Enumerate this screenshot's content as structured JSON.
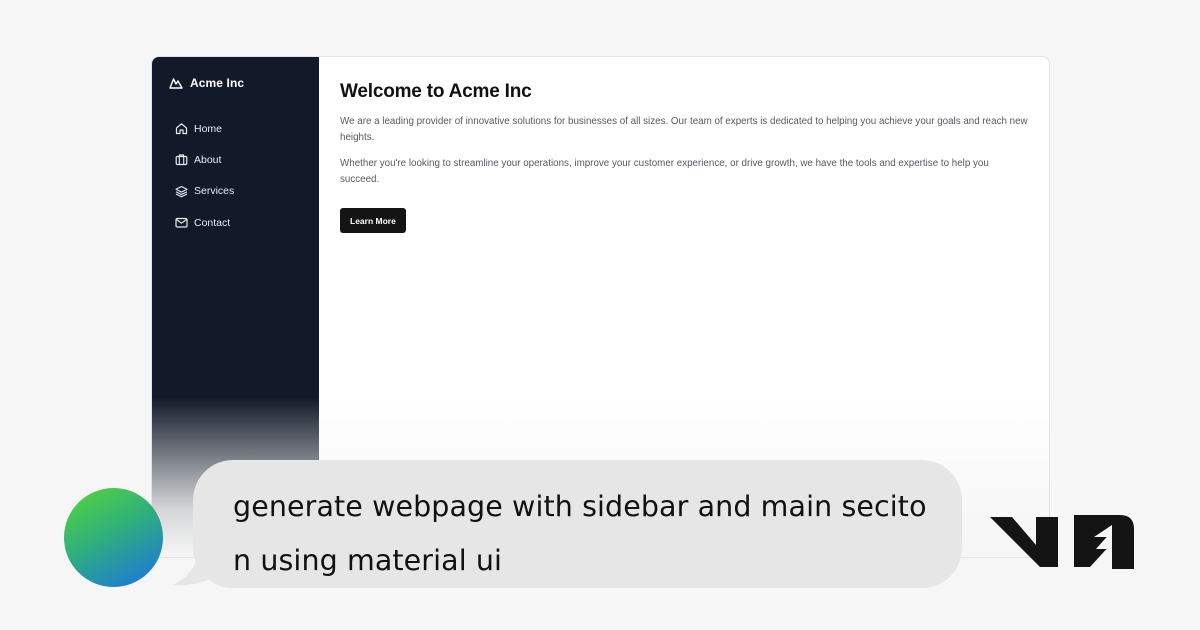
{
  "app": {
    "brand_name": "Acme Inc",
    "brand_icon": "mountain-icon",
    "nav": [
      {
        "label": "Home",
        "icon": "home-icon"
      },
      {
        "label": "About",
        "icon": "briefcase-icon"
      },
      {
        "label": "Services",
        "icon": "layers-icon"
      },
      {
        "label": "Contact",
        "icon": "mail-icon"
      }
    ],
    "main": {
      "title": "Welcome to Acme Inc",
      "paragraph_1": "We are a leading provider of innovative solutions for businesses of all sizes. Our team of experts is dedicated to helping you achieve your goals and reach new heights.",
      "paragraph_2": "Whether you're looking to streamline your operations, improve your customer experience, or drive growth, we have the tools and expertise to help you succeed.",
      "cta_label": "Learn More"
    },
    "colors": {
      "sidebar_bg": "#121a29",
      "button_bg": "#141414",
      "page_bg": "#f6f6f6"
    }
  },
  "prompt": {
    "text": "generate webpage with sidebar and main seciton using material ui"
  },
  "logo": {
    "name": "v0-logo"
  }
}
